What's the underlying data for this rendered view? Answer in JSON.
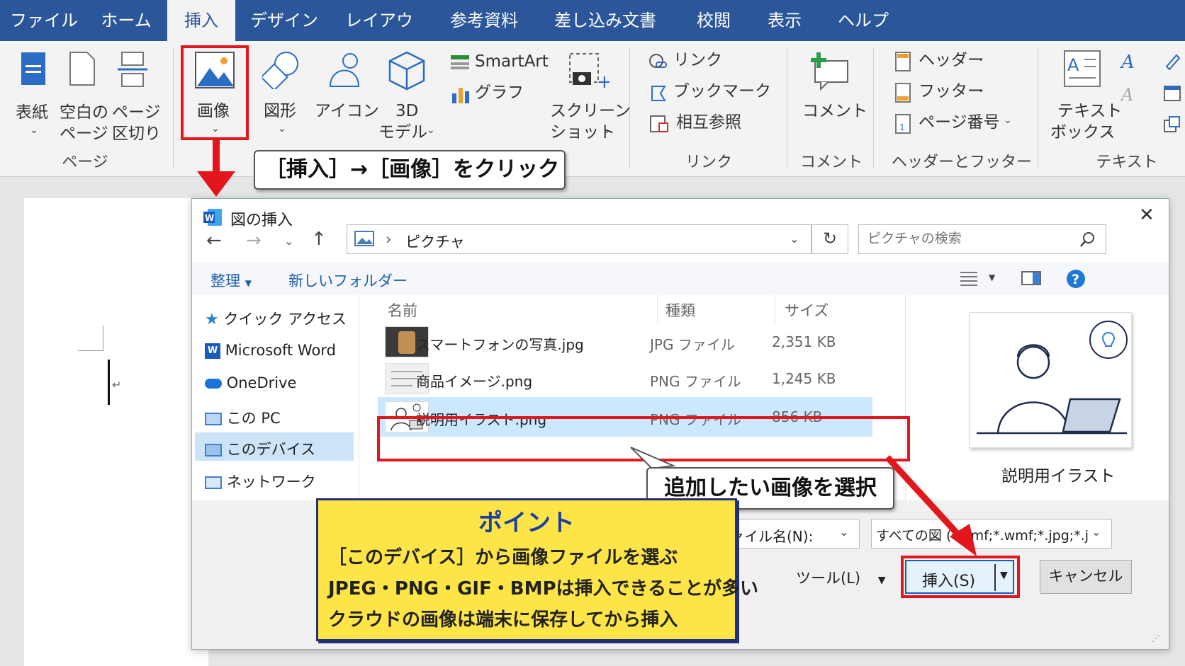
{
  "tabs": [
    "ファイル",
    "ホーム",
    "挿入",
    "デザイン",
    "レイアウト",
    "参考資料",
    "差し込み文書",
    "校閲",
    "表示",
    "ヘルプ"
  ],
  "ribbon": {
    "page_group": {
      "cover": "表紙",
      "blank_1": "空白の",
      "blank_2": "ページ",
      "break_1": "ページ",
      "break_2": "区切り",
      "title": "ページ"
    },
    "image": "画像",
    "shapes": "図形",
    "icons": "アイコン",
    "model_1": "3D",
    "model_2": "モデル",
    "smartart": "SmartArt",
    "graph": "グラフ",
    "screenshot_1": "スクリーン",
    "screenshot_2": "ショット",
    "link": "リンク",
    "bookmark": "ブックマーク",
    "crossref": "相互参照",
    "link_title": "リンク",
    "comment": "コメント",
    "comment_title": "コメント",
    "header": "ヘッダー",
    "footer": "フッター",
    "pagenum": "ページ番号",
    "hf_title": "ヘッダーとフッター",
    "textbox_1": "テキスト",
    "textbox_2": "ボックス",
    "text_title": "テキスト"
  },
  "callouts": {
    "insert_image": "［挿入］→［画像］をクリック",
    "select": "追加したい画像を選択"
  },
  "point": {
    "title": "ポイント",
    "lines": [
      "［このデバイス］から画像ファイルを選ぶ",
      "JPEG・PNG・GIF・BMPは挿入できることが多い",
      "クラウドの画像は端末に保存してから挿入"
    ]
  },
  "dialog": {
    "title": "図の挿入",
    "path": "ピクチャ",
    "search_placeholder": "ピクチャの検索",
    "organize": "整理",
    "new_folder": "新しいフォルダー",
    "nav": [
      "クイック アクセス",
      "Microsoft Word",
      "OneDrive",
      "この PC",
      "このデバイス",
      "ネットワーク"
    ],
    "columns": [
      "名前",
      "種類",
      "サイズ"
    ],
    "files": [
      {
        "name": "スマートフォンの写真.jpg",
        "type": "JPG ファイル",
        "size": "2,351 KB"
      },
      {
        "name": "商品イメージ.png",
        "type": "PNG ファイル",
        "size": "1,245 KB"
      },
      {
        "name": "説明用イラスト.png",
        "type": "PNG ファイル",
        "size": "856 KB"
      }
    ],
    "preview_caption": "説明用イラスト",
    "filename_label": "ファイル名(N):",
    "filter": "すべての図 (*.emf;*.wmf;*.jpg;*.j",
    "tools": "ツール(L)",
    "insert": "挿入(S)",
    "cancel": "キャンセル"
  },
  "colors": {
    "accent": "#2b579a",
    "highlight": "#e3161b",
    "point_bg": "#fde548"
  }
}
